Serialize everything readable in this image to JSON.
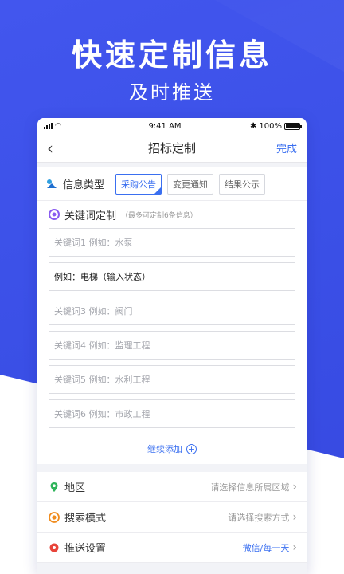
{
  "hero": {
    "title": "快速定制信息",
    "subtitle": "及时推送"
  },
  "status_bar": {
    "time": "9:41 AM",
    "battery": "100%",
    "bluetooth": "✱"
  },
  "nav": {
    "back": "‹",
    "title": "招标定制",
    "done": "完成"
  },
  "info_type": {
    "label": "信息类型",
    "options": [
      {
        "label": "采购公告",
        "selected": true
      },
      {
        "label": "变更通知",
        "selected": false
      },
      {
        "label": "结果公示",
        "selected": false
      }
    ]
  },
  "keywords": {
    "title": "关键词定制",
    "hint": "（最多可定制6条信息）",
    "inputs": [
      {
        "text": "关键词1  例如：水泵",
        "filled": false
      },
      {
        "text": "例如：电梯（输入状态）",
        "filled": true
      },
      {
        "text": "关键词3  例如：阀门",
        "filled": false
      },
      {
        "text": "关键词4  例如：监理工程",
        "filled": false
      },
      {
        "text": "关键词5  例如：水利工程",
        "filled": false
      },
      {
        "text": "关键词6  例如：市政工程",
        "filled": false
      }
    ],
    "add_more": "继续添加"
  },
  "settings": {
    "region": {
      "label": "地区",
      "value": "请选择信息所属区域"
    },
    "search_mode": {
      "label": "搜索模式",
      "value": "请选择搜索方式"
    },
    "push": {
      "label": "推送设置",
      "value": "微信/每一天"
    }
  },
  "colors": {
    "accent": "#3a6ff0",
    "hero_bg": "#4256ee",
    "region_icon": "#2fb45a",
    "search_icon": "#f08c1e",
    "push_icon": "#e8443a"
  }
}
